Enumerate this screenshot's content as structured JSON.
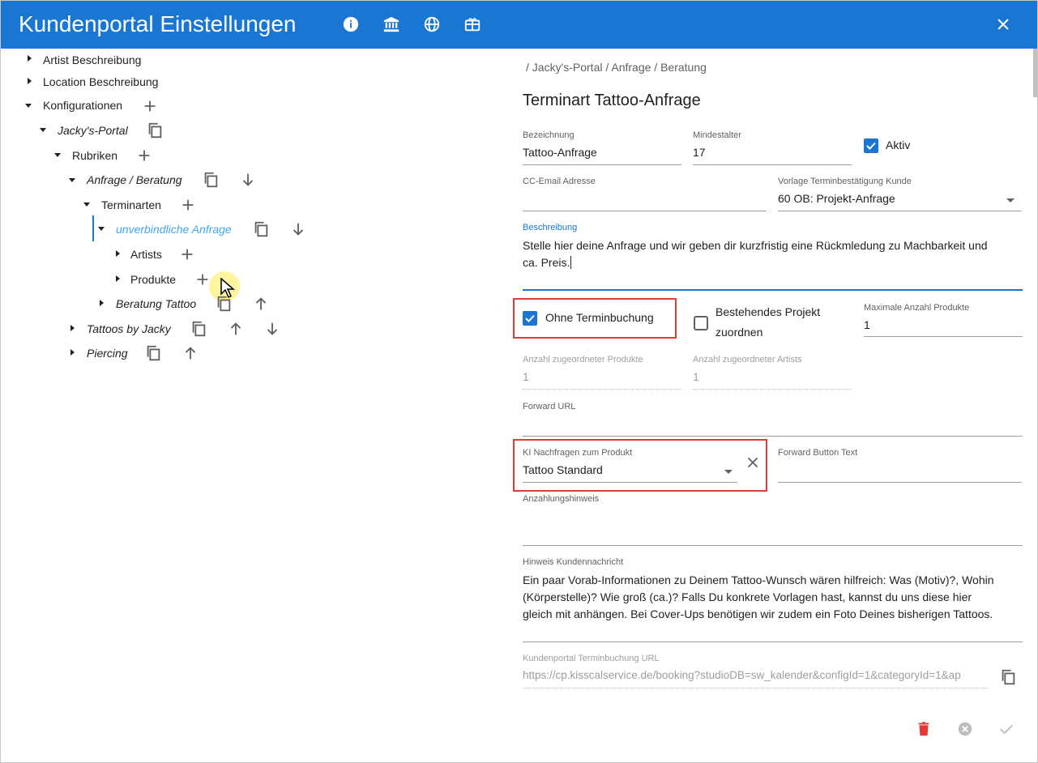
{
  "header": {
    "title": "Kundenportal Einstellungen"
  },
  "tree": {
    "artist_desc": "Artist Beschreibung",
    "location_desc": "Location Beschreibung",
    "konfig": "Konfigurationen",
    "portal": "Jacky's-Portal",
    "rubriken": "Rubriken",
    "anfrage": "Anfrage / Beratung",
    "terminarten": "Terminarten",
    "unverbindlich": "unverbindliche Anfrage",
    "artists": "Artists",
    "produkte": "Produkte",
    "beratung": "Beratung Tattoo",
    "tattoos": "Tattoos by Jacky",
    "piercing": "Piercing"
  },
  "form": {
    "breadcrumb": "/ Jacky's-Portal / Anfrage / Beratung",
    "title": "Terminart Tattoo-Anfrage",
    "bezeichnung_label": "Bezeichnung",
    "bezeichnung": "Tattoo-Anfrage",
    "mindestalter_label": "Mindestalter",
    "mindestalter": "17",
    "aktiv_label": "Aktiv",
    "cc_label": "CC-Email Adresse",
    "cc": "",
    "vorlage_label": "Vorlage Terminbestätigung Kunde",
    "vorlage": "60 OB: Projekt-Anfrage",
    "beschreibung_label": "Beschreibung",
    "beschreibung_1": "Stelle hier deine Anfrage und wir geben dir kurzfristig eine Rückmledung zu Machbarkeit und",
    "beschreibung_2": "ca. Preis.",
    "ohne_label": "Ohne Terminbuchung",
    "bestehend_1": "Bestehendes Projekt",
    "bestehend_2": "zuordnen",
    "max_label": "Maximale Anzahl Produkte",
    "max": "1",
    "anz_prod_label": "Anzahl zugeordneter Produkte",
    "anz_prod": "1",
    "anz_art_label": "Anzahl zugeordneter Artists",
    "anz_art": "1",
    "forward_url_label": "Forward URL",
    "ki_label": "KI Nachfragen zum Produkt",
    "ki": "Tattoo Standard",
    "forward_btn_label": "Forward Button Text",
    "anzahlung_label": "Anzahlungshinweis",
    "hinweis_label": "Hinweis Kundennachricht",
    "hinweis_1": "Ein paar Vorab-Informationen zu Deinem Tattoo-Wunsch wären hilfreich: Was (Motiv)?, Wohin",
    "hinweis_2": "(Körperstelle)? Wie groß (ca.)? Falls Du konkrete Vorlagen hast, kannst du uns diese hier",
    "hinweis_3": "gleich mit anhängen. Bei Cover-Ups benötigen wir zudem ein Foto Deines bisherigen Tattoos.",
    "url_label": "Kundenportal Terminbuchung URL",
    "url": "https://cp.kisscalservice.de/booking?studioDB=sw_kalender&configId=1&categoryId=1&ap"
  },
  "colors": {
    "primary": "#1976d2",
    "danger": "#e53935",
    "link": "#42a5f5"
  }
}
